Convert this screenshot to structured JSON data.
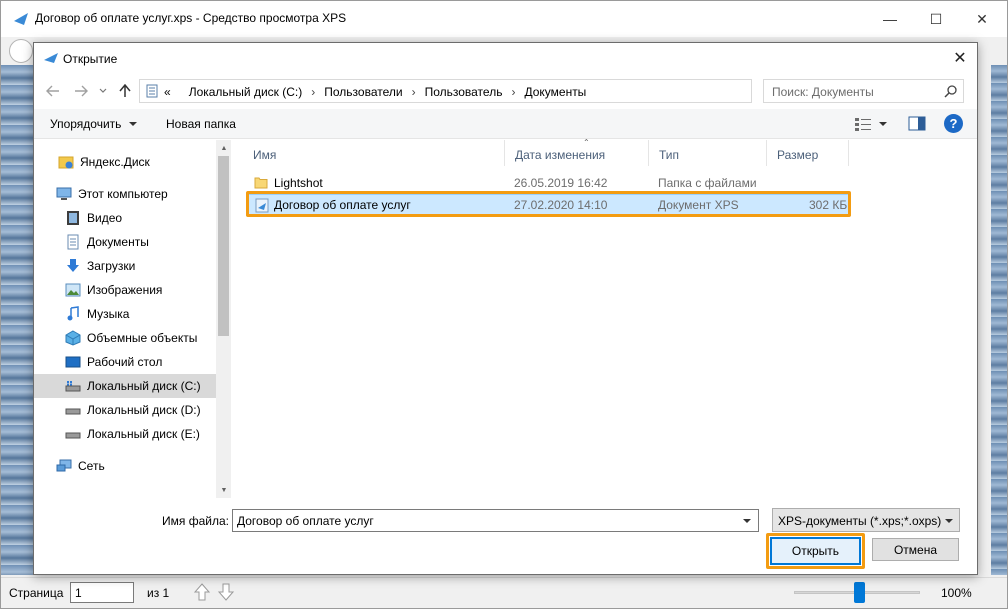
{
  "window": {
    "title": "Договор об оплате услуг.xps - Средство просмотра XPS",
    "minimize_glyph": "—",
    "maximize_glyph": "☐",
    "close_glyph": "✕"
  },
  "dialog": {
    "title": "Открытие",
    "close_glyph": "✕",
    "breadcrumb_prefix": "«",
    "breadcrumb": [
      "Локальный диск (C:)",
      "Пользователи",
      "Пользователь",
      "Документы"
    ],
    "search_placeholder": "Поиск: Документы",
    "organize_label": "Упорядочить",
    "new_folder_label": "Новая папка",
    "help_glyph": "?"
  },
  "nav_pane": {
    "items": [
      {
        "label": "Яндекс.Диск",
        "icon": "yandex-disk-icon"
      },
      {
        "label": "Этот компьютер",
        "icon": "computer-icon"
      },
      {
        "label": "Видео",
        "icon": "video-icon"
      },
      {
        "label": "Документы",
        "icon": "documents-icon"
      },
      {
        "label": "Загрузки",
        "icon": "downloads-icon"
      },
      {
        "label": "Изображения",
        "icon": "pictures-icon"
      },
      {
        "label": "Музыка",
        "icon": "music-icon"
      },
      {
        "label": "Объемные объекты",
        "icon": "3d-objects-icon"
      },
      {
        "label": "Рабочий стол",
        "icon": "desktop-icon"
      },
      {
        "label": "Локальный диск (C:)",
        "icon": "system-drive-icon"
      },
      {
        "label": "Локальный диск (D:)",
        "icon": "drive-icon"
      },
      {
        "label": "Локальный диск (E:)",
        "icon": "drive-icon"
      },
      {
        "label": "Сеть",
        "icon": "network-icon"
      }
    ],
    "selected": "Локальный диск (C:)"
  },
  "file_list": {
    "columns": [
      "Имя",
      "Дата изменения",
      "Тип",
      "Размер"
    ],
    "rows": [
      {
        "name": "Lightshot",
        "date": "26.05.2019 16:42",
        "type": "Папка с файлами",
        "size": "",
        "icon": "folder-icon"
      },
      {
        "name": "Договор об оплате услуг",
        "date": "27.02.2020 14:10",
        "type": "Документ XPS",
        "size": "302 КБ",
        "icon": "xps-file-icon"
      }
    ]
  },
  "bottom": {
    "filename_label": "Имя файла:",
    "filename_value": "Договор об оплате услуг",
    "filter_value": "XPS-документы (*.xps;*.oxps)",
    "open_label": "Открыть",
    "cancel_label": "Отмена"
  },
  "statusbar": {
    "page_label": "Страница",
    "page_value": "1",
    "page_of": "из 1",
    "zoom_label": "100%",
    "zoom_percent": 100
  },
  "colors": {
    "accent": "#0078d7",
    "highlight": "#f39c12",
    "selection": "#cce8ff"
  }
}
